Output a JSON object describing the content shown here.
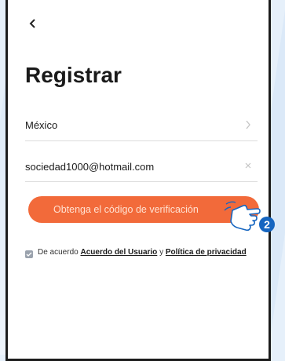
{
  "header": {
    "back_icon": "chevron-left-icon",
    "title": "Registrar"
  },
  "form": {
    "country": {
      "value": "México",
      "icon": "chevron-right-icon"
    },
    "email": {
      "value": "sociedad1000@hotmail.com",
      "icon": "clear-x-icon"
    }
  },
  "verify_button": {
    "label": "Obtenga el código de verificación",
    "color": "#f26a3a"
  },
  "agreement": {
    "checked": true,
    "prefix": "De acuerdo ",
    "user_agreement": "Acuerdo del Usuario",
    "conjunction": " y ",
    "privacy_policy": "Política de privacidad"
  },
  "annotation": {
    "step_number": "2",
    "icon": "tap-hand-icon",
    "color": "#1565c0"
  }
}
